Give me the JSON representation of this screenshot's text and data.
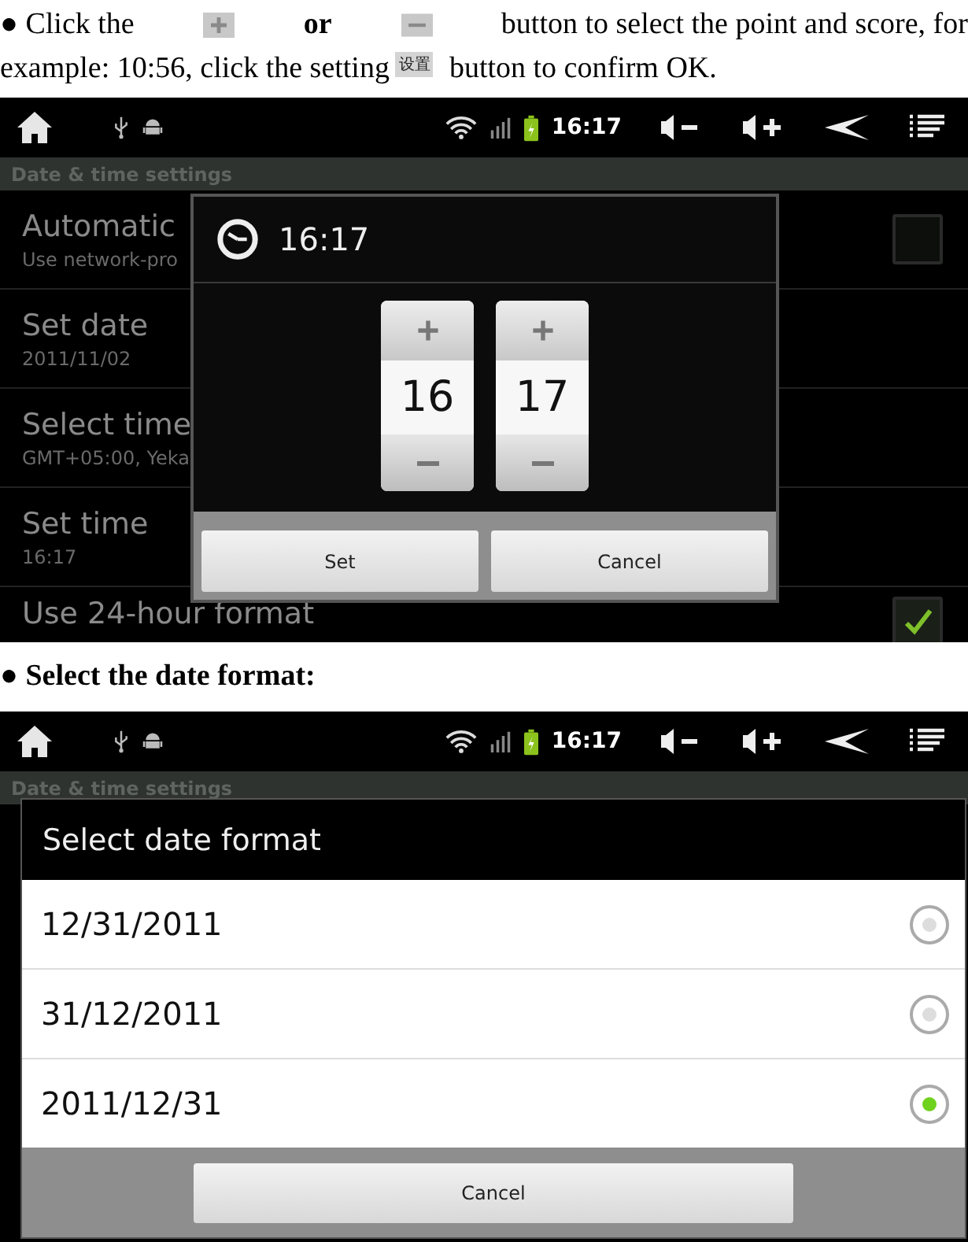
{
  "blocks": [
    {
      "kind": "paragraph",
      "lines": [
        [
          {
            "kind": "text",
            "text": "●  Click the"
          },
          {
            "kind": "plus"
          },
          {
            "kind": "text",
            "text": "or",
            "bold": true
          },
          {
            "kind": "minus"
          },
          {
            "kind": "text",
            "text": "button to select the point and score, for"
          }
        ],
        [
          {
            "kind": "text",
            "text": "example: 10:56, click the setting"
          },
          {
            "kind": "chip",
            "text": "设置"
          },
          {
            "kind": "text",
            "text": "button to confirm OK."
          }
        ]
      ]
    },
    {
      "kind": "time-screen",
      "status_time": "16:17",
      "header": "Date & time settings",
      "settings": [
        {
          "title": "Automatic",
          "summary": "Use network-pro",
          "checkbox": true,
          "checked": false
        },
        {
          "title": "Set date",
          "summary": "2011/11/02"
        },
        {
          "title": "Select time",
          "summary": "GMT+05:00, Yeka"
        },
        {
          "title": "Set time",
          "summary": "16:17"
        },
        {
          "title": "Use 24-hour format",
          "checkbox": true,
          "checked": true
        }
      ],
      "dialog": {
        "title": "16:17",
        "pickers": [
          {
            "value": "16"
          },
          {
            "value": "17"
          }
        ],
        "buttons": [
          "Set",
          "Cancel"
        ]
      }
    },
    {
      "kind": "heading",
      "text": "● Select the date format:"
    },
    {
      "kind": "date-screen",
      "status_time": "16:17",
      "header": "Date & time settings",
      "dialog": {
        "title": "Select date format",
        "options": [
          {
            "label": "12/31/2011",
            "selected": false
          },
          {
            "label": "31/12/2011",
            "selected": false
          },
          {
            "label": "2011/12/31",
            "selected": true
          }
        ],
        "buttons": [
          "Cancel"
        ]
      }
    }
  ]
}
